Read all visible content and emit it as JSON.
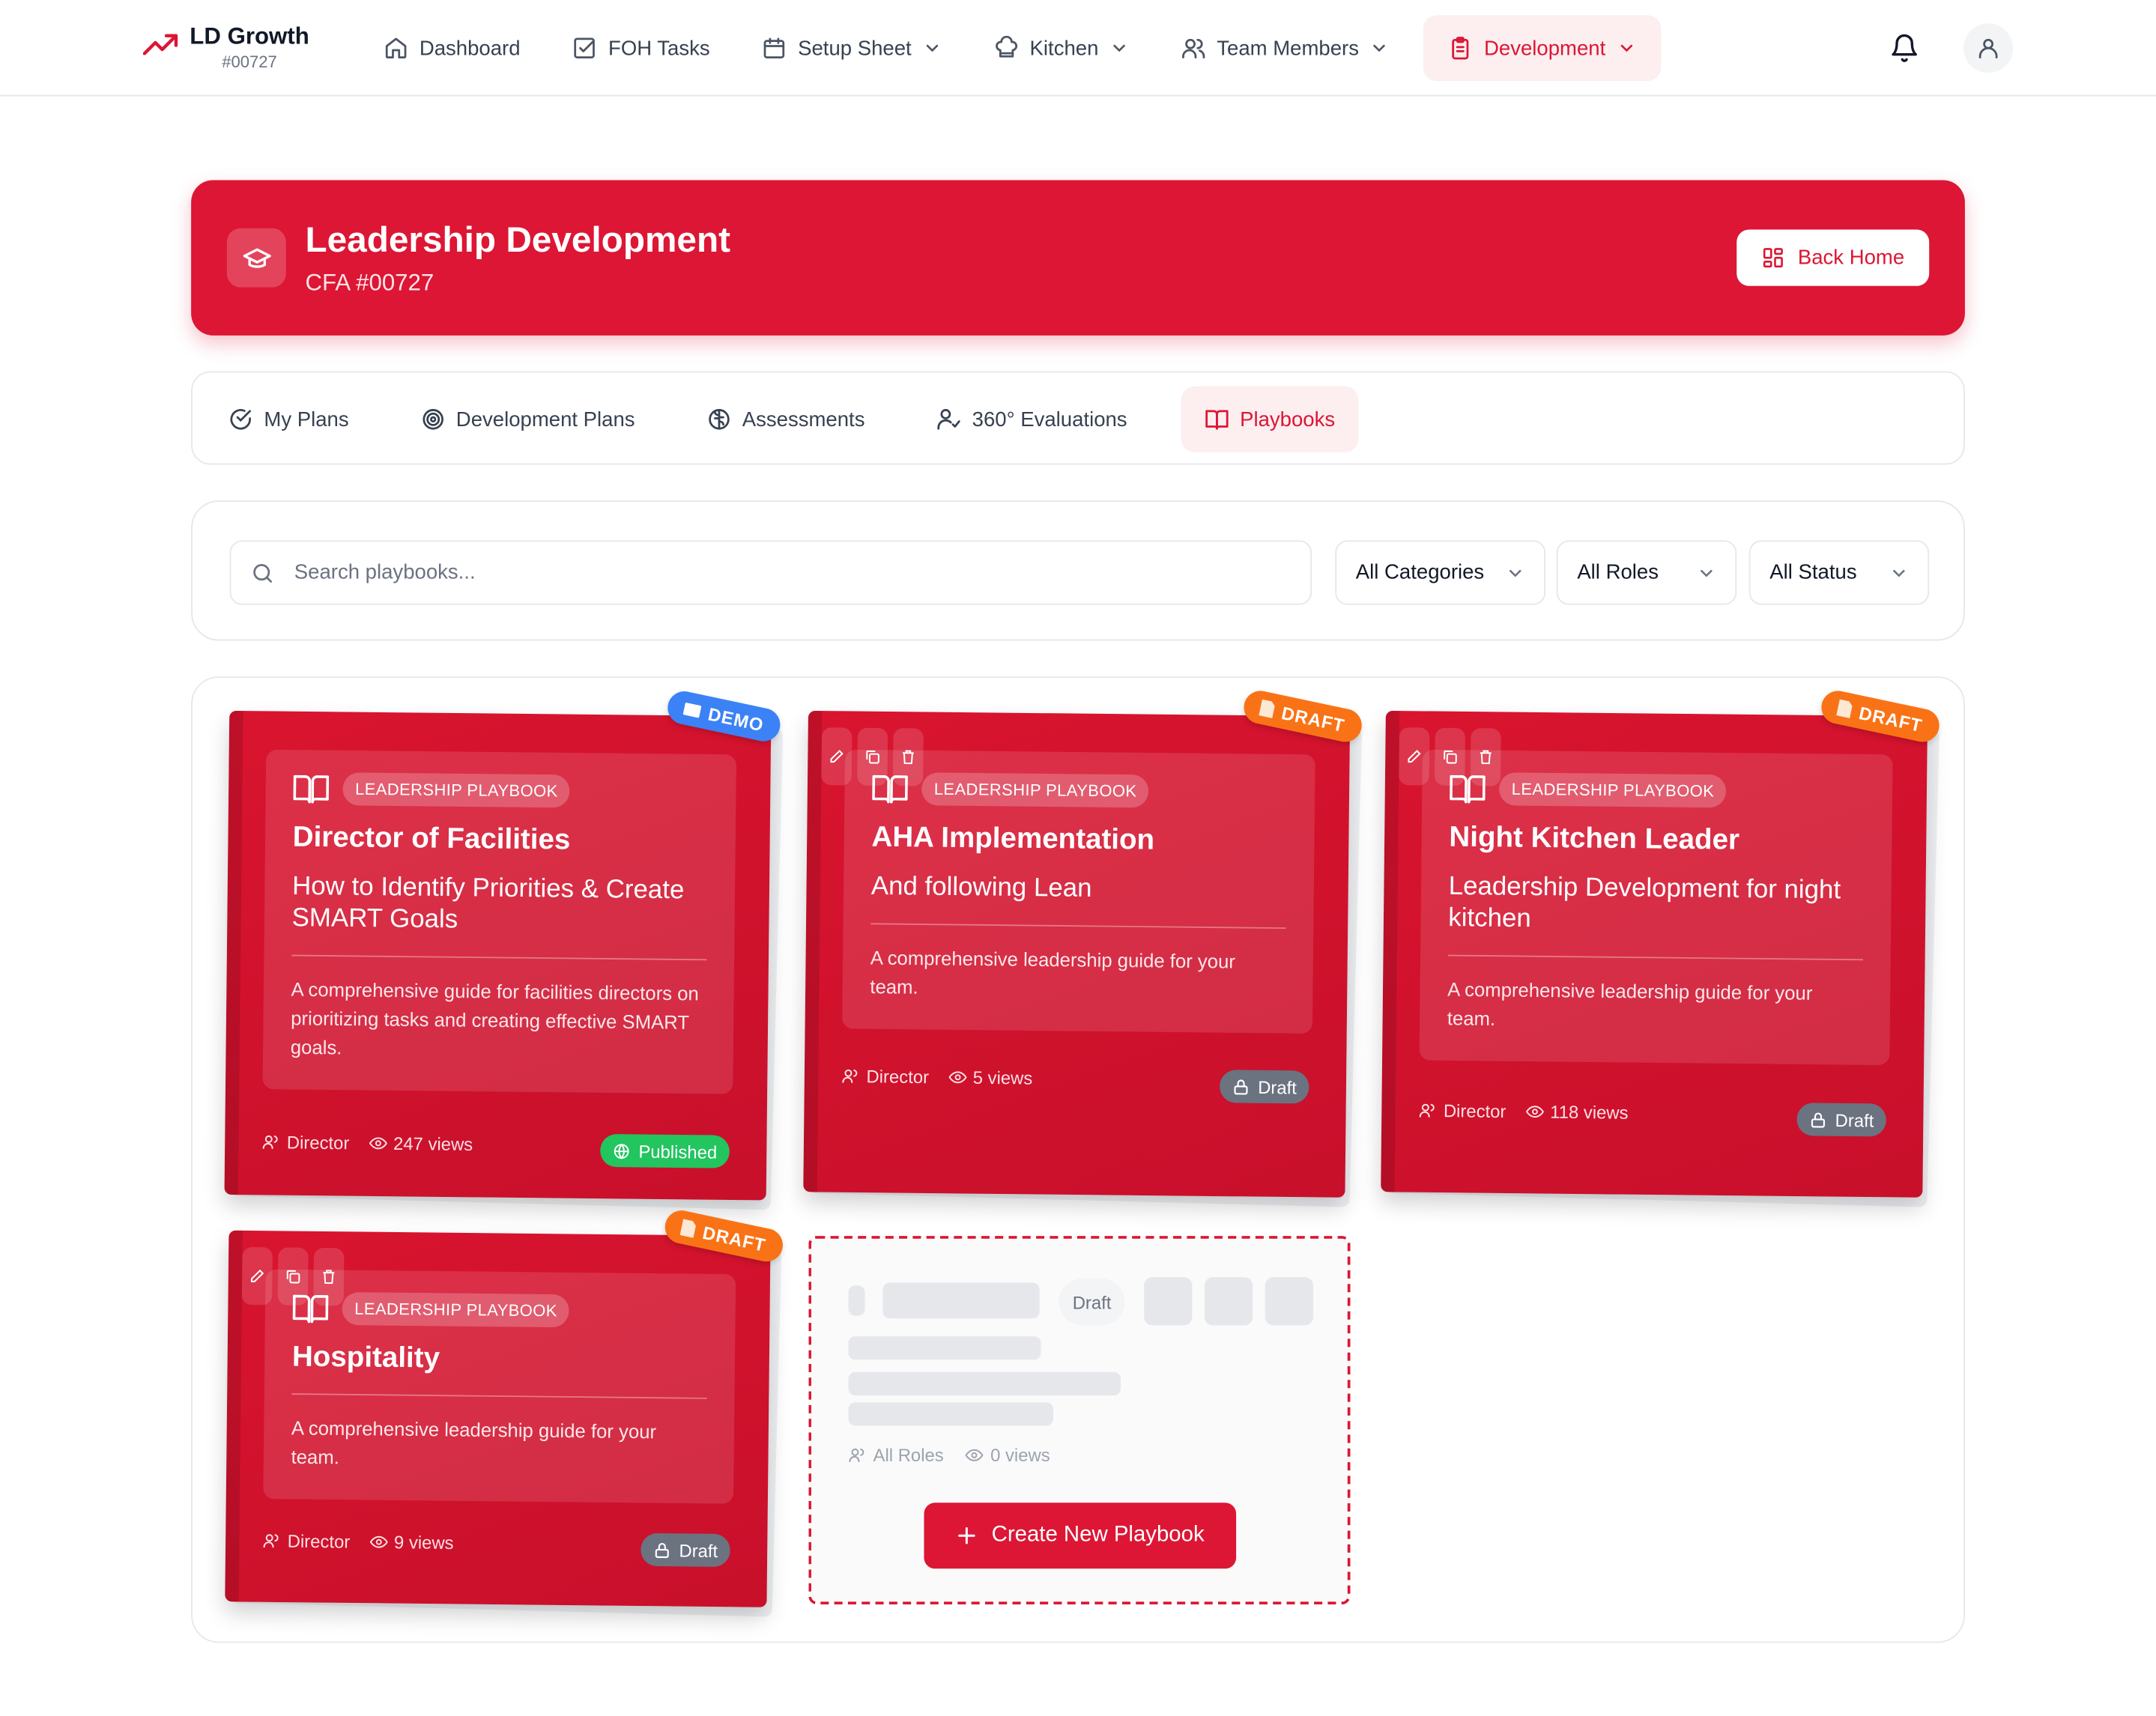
{
  "brand": {
    "name": "LD Growth",
    "number": "#00727"
  },
  "nav": {
    "items": [
      {
        "label": "Dashboard",
        "icon": "home-icon"
      },
      {
        "label": "FOH Tasks",
        "icon": "checkbox-icon"
      },
      {
        "label": "Setup Sheet",
        "icon": "calendar-icon",
        "dropdown": true
      },
      {
        "label": "Kitchen",
        "icon": "chef-hat-icon",
        "dropdown": true
      },
      {
        "label": "Team Members",
        "icon": "users-icon",
        "dropdown": true
      },
      {
        "label": "Development",
        "icon": "clipboard-icon",
        "dropdown": true,
        "active": true
      }
    ]
  },
  "hero": {
    "title": "Leadership Development",
    "subtitle": "CFA #00727",
    "back_label": "Back Home"
  },
  "tabs": [
    {
      "label": "My Plans",
      "icon": "check-circle-icon"
    },
    {
      "label": "Development Plans",
      "icon": "target-icon"
    },
    {
      "label": "Assessments",
      "icon": "brain-icon"
    },
    {
      "label": "360° Evaluations",
      "icon": "user-check-icon"
    },
    {
      "label": "Playbooks",
      "icon": "book-open-icon",
      "active": true
    }
  ],
  "filters": {
    "search_placeholder": "Search playbooks...",
    "categories": "All Categories",
    "roles": "All Roles",
    "status": "All Status"
  },
  "playbooks": [
    {
      "tag": "LEADERSHIP PLAYBOOK",
      "title": "Director of Facilities",
      "subtitle": "How to Identify Priorities & Create SMART Goals",
      "description": "A comprehensive guide for facilities directors on prioritizing tasks and creating effective SMART goals.",
      "role": "Director",
      "views": "247 views",
      "status": "Published",
      "ribbon": "DEMO"
    },
    {
      "tag": "LEADERSHIP PLAYBOOK",
      "title": "AHA Implementation",
      "subtitle": "And following Lean",
      "description": "A comprehensive leadership guide for your team.",
      "role": "Director",
      "views": "5 views",
      "status": "Draft",
      "ribbon": "DRAFT"
    },
    {
      "tag": "LEADERSHIP PLAYBOOK",
      "title": "Night Kitchen Leader",
      "subtitle": "Leadership Development for night kitchen",
      "description": "A comprehensive leadership guide for your team.",
      "role": "Director",
      "views": "118 views",
      "status": "Draft",
      "ribbon": "DRAFT"
    },
    {
      "tag": "LEADERSHIP PLAYBOOK",
      "title": "Hospitality",
      "subtitle": "",
      "description": "A comprehensive leadership guide for your team.",
      "role": "Director",
      "views": "9 views",
      "status": "Draft",
      "ribbon": "DRAFT"
    }
  ],
  "create_card": {
    "draft_label": "Draft",
    "roles": "All Roles",
    "views": "0 views",
    "button_label": "Create New Playbook"
  },
  "colors": {
    "brand_red": "#dc1634",
    "published_green": "#22c55e",
    "draft_gray": "#6b7280",
    "demo_blue": "#3b82f6",
    "draft_orange": "#f97316"
  }
}
